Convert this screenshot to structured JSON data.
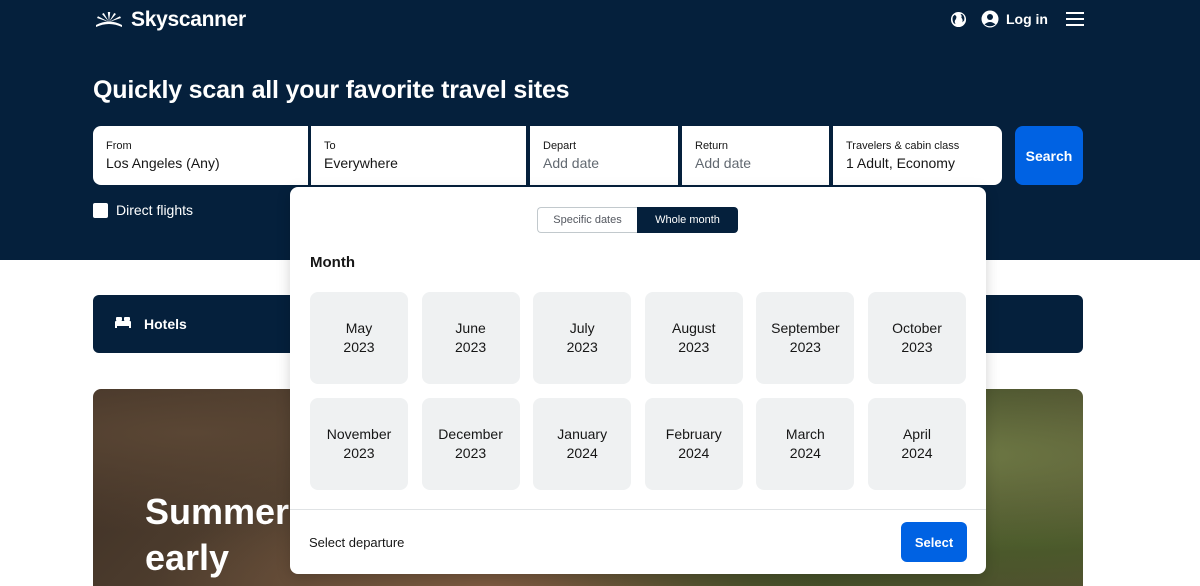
{
  "header": {
    "brand": "Skyscanner",
    "login_label": "Log in",
    "icons": {
      "language": "globe-icon",
      "account": "user-circle-icon",
      "menu": "hamburger-menu-icon"
    }
  },
  "hero": {
    "headline": "Quickly scan all your favorite travel sites"
  },
  "search_form": {
    "from": {
      "label": "From",
      "value": "Los Angeles (Any)"
    },
    "to": {
      "label": "To",
      "value": "Everywhere"
    },
    "depart": {
      "label": "Depart",
      "placeholder": "Add date"
    },
    "return": {
      "label": "Return",
      "placeholder": "Add date"
    },
    "travelers": {
      "label": "Travelers & cabin class",
      "value": "1 Adult, Economy"
    },
    "search_label": "Search",
    "direct_flights": {
      "label": "Direct flights",
      "checked": false
    }
  },
  "hotels_bar": {
    "label": "Hotels",
    "icon": "bed-icon"
  },
  "promo": {
    "title": "Summer early"
  },
  "date_picker": {
    "toggle": {
      "specific_label": "Specific dates",
      "whole_month_label": "Whole month",
      "active": "Whole month"
    },
    "heading": "Month",
    "months": [
      {
        "month": "May",
        "year": "2023"
      },
      {
        "month": "June",
        "year": "2023"
      },
      {
        "month": "July",
        "year": "2023"
      },
      {
        "month": "August",
        "year": "2023"
      },
      {
        "month": "September",
        "year": "2023"
      },
      {
        "month": "October",
        "year": "2023"
      },
      {
        "month": "November",
        "year": "2023"
      },
      {
        "month": "December",
        "year": "2023"
      },
      {
        "month": "January",
        "year": "2024"
      },
      {
        "month": "February",
        "year": "2024"
      },
      {
        "month": "March",
        "year": "2024"
      },
      {
        "month": "April",
        "year": "2024"
      }
    ],
    "status_text": "Select departure",
    "select_label": "Select"
  },
  "colors": {
    "navy": "#05203c",
    "accent_blue": "#0062e3",
    "tile_bg": "#eff1f2"
  }
}
